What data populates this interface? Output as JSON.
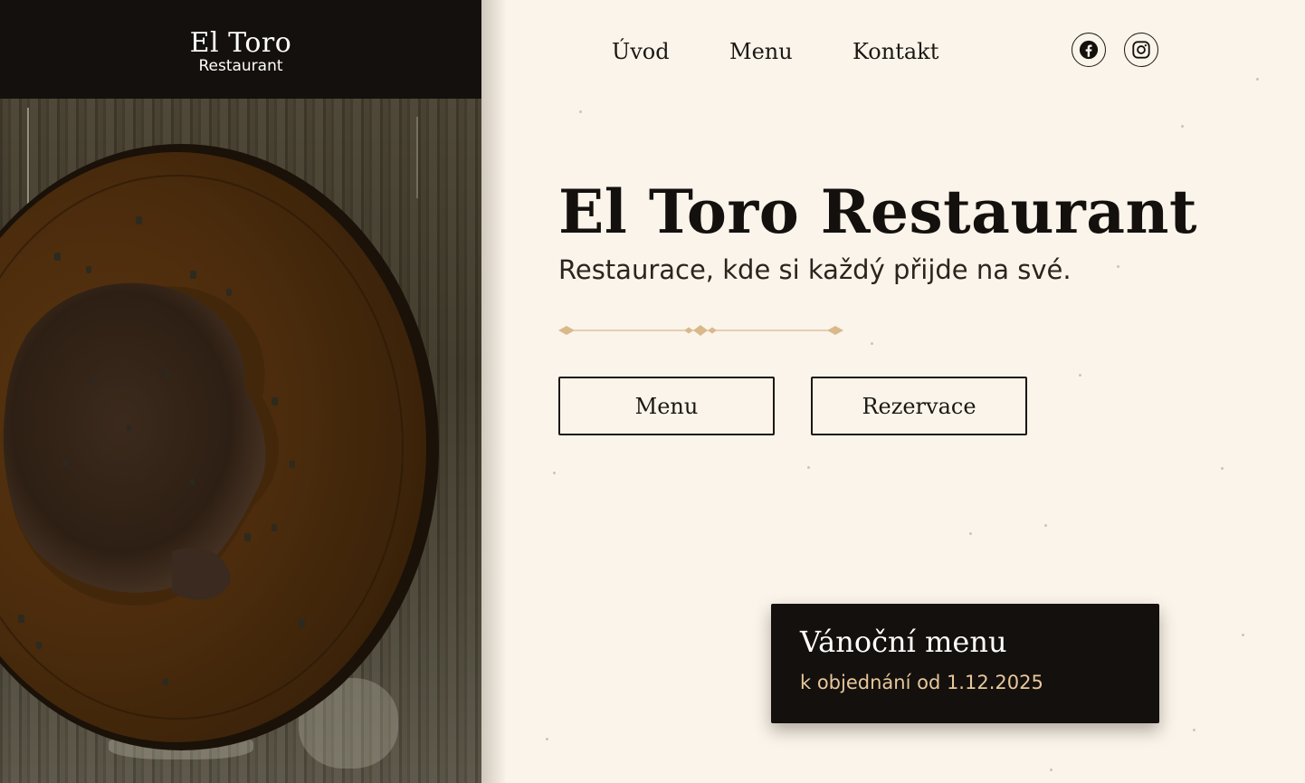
{
  "brand": {
    "name": "El Toro",
    "subtitle": "Restaurant"
  },
  "nav": {
    "items": [
      {
        "label": "Úvod"
      },
      {
        "label": "Menu"
      },
      {
        "label": "Kontakt"
      }
    ]
  },
  "social": {
    "facebook_icon": "facebook-icon",
    "instagram_icon": "instagram-icon"
  },
  "hero": {
    "title": "El Toro Restaurant",
    "subtitle": "Restaurace, kde si každý přijde na své.",
    "buttons": {
      "menu_label": "Menu",
      "reservation_label": "Rezervace"
    }
  },
  "promo": {
    "title": "Vánoční menu",
    "subtitle": "k objednání od 1.12.2025"
  },
  "colors": {
    "background": "#faf4ea",
    "dark": "#14100d",
    "accent_gold": "#e7c79a",
    "divider_gold": "#d9b98a"
  }
}
